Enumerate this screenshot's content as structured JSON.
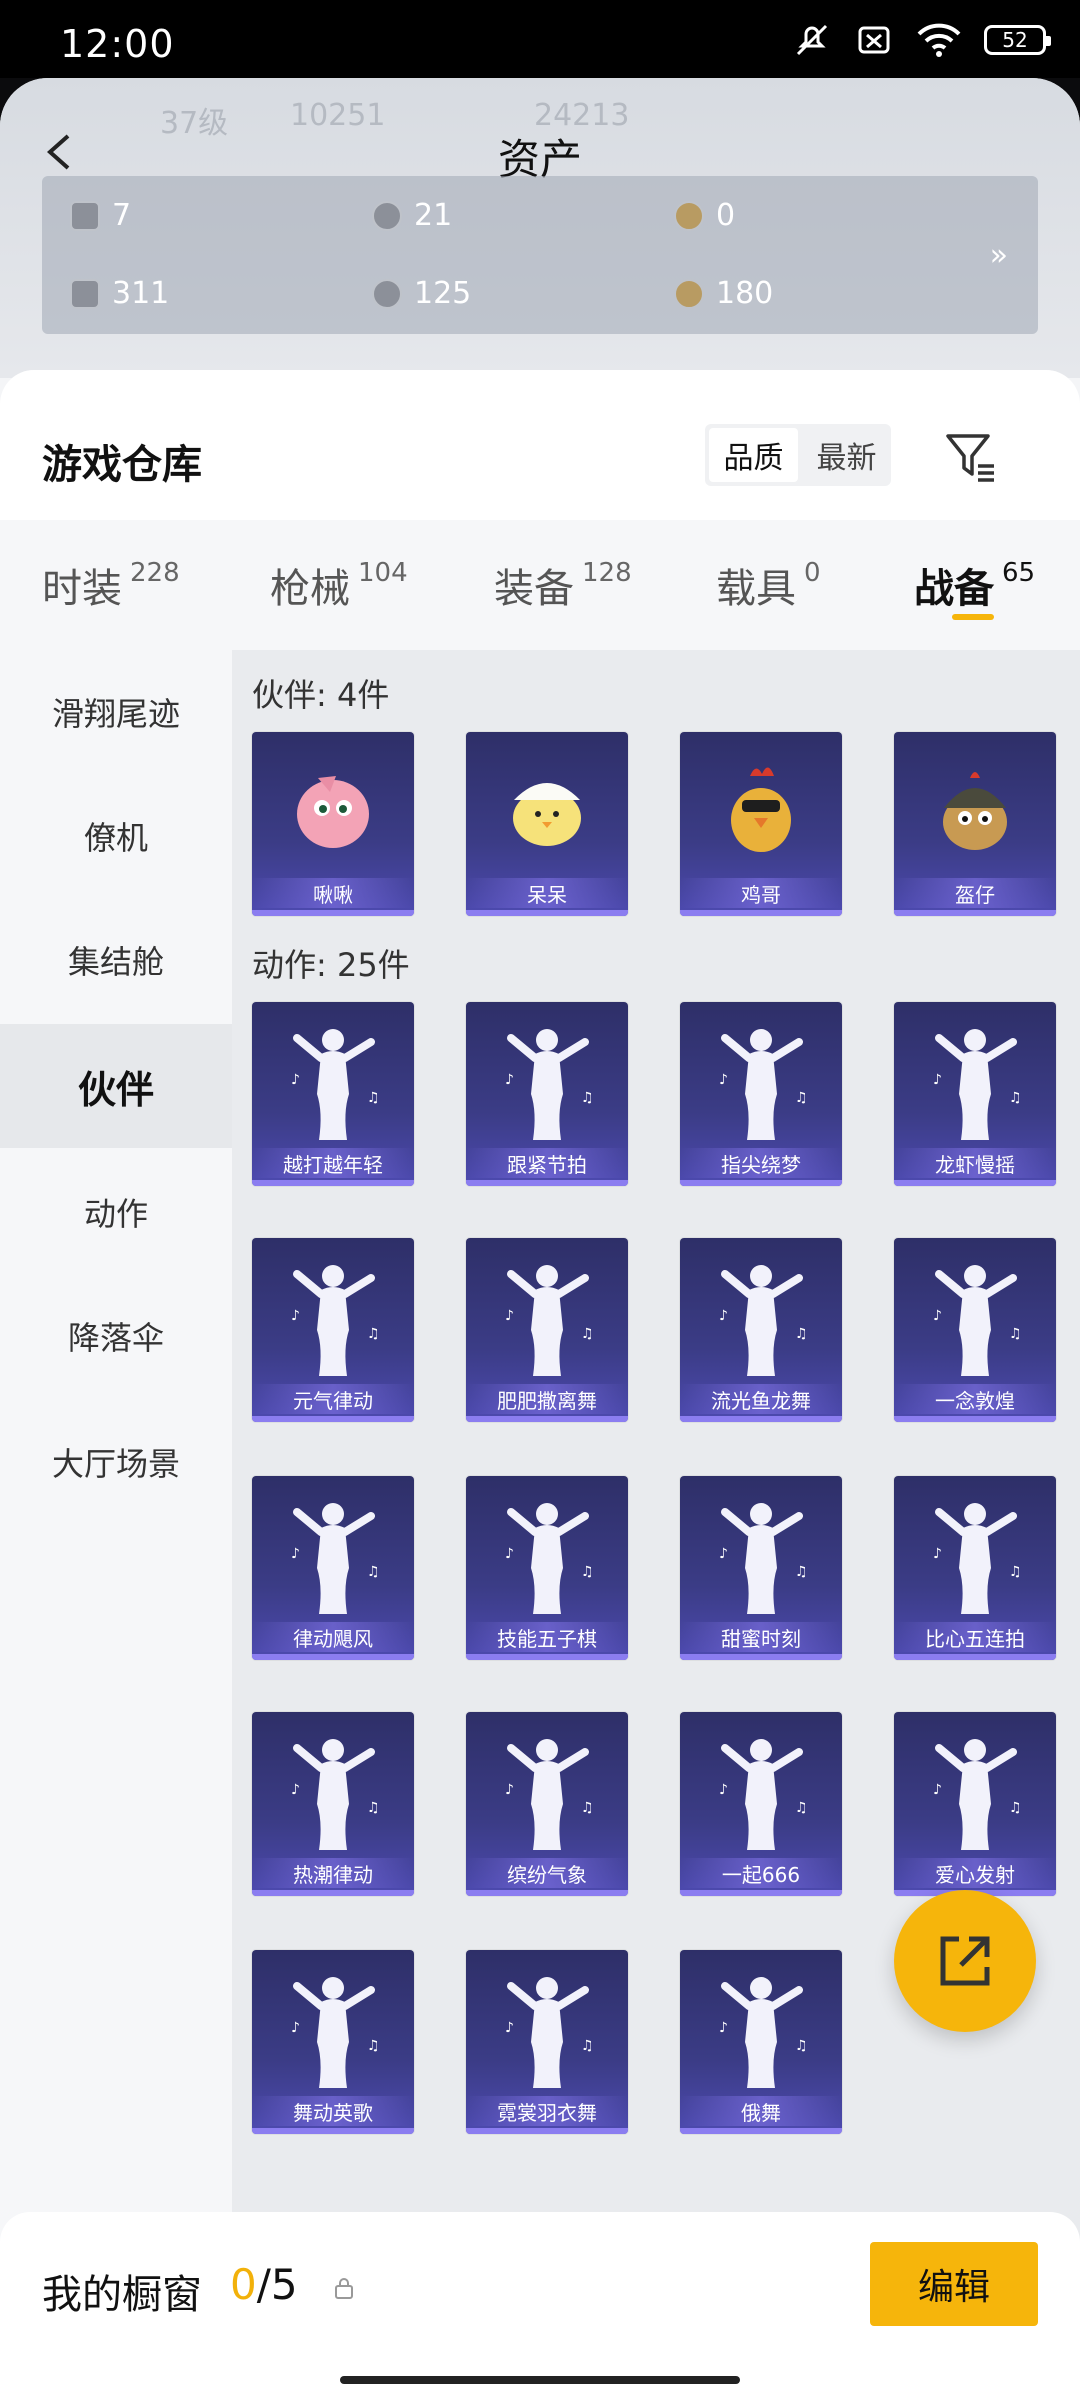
{
  "status": {
    "time": "12:00",
    "battery": "52"
  },
  "header": {
    "title": "资产",
    "ghost": [
      "37级",
      "10251",
      "24213"
    ],
    "assets": [
      {
        "icon": "card-icon",
        "value": "7"
      },
      {
        "icon": "silver-coin-icon",
        "value": "21"
      },
      {
        "icon": "gold-coin-icon",
        "value": "0"
      },
      {
        "icon": "ticket-icon",
        "value": "311"
      },
      {
        "icon": "token-icon",
        "value": "125"
      },
      {
        "icon": "bronze-coin-icon",
        "value": "180"
      }
    ],
    "more": "»"
  },
  "sheet": {
    "title": "游戏仓库",
    "sort": [
      "品质",
      "最新"
    ]
  },
  "tabs": [
    {
      "label": "时装",
      "count": "228"
    },
    {
      "label": "枪械",
      "count": "104"
    },
    {
      "label": "装备",
      "count": "128"
    },
    {
      "label": "载具",
      "count": "0"
    },
    {
      "label": "战备",
      "count": "65"
    }
  ],
  "sidebar": [
    "滑翔尾迹",
    "僚机",
    "集结舱",
    "伙伴",
    "动作",
    "降落伞",
    "大厅场景"
  ],
  "sections": {
    "companion": {
      "label": "伙伴: 4件",
      "items": [
        "啾啾",
        "呆呆",
        "鸡哥",
        "盔仔"
      ]
    },
    "emote": {
      "label": "动作: 25件",
      "items": [
        "越打越年轻",
        "跟紧节拍",
        "指尖绕梦",
        "龙虾慢摇",
        "元气律动",
        "肥肥撒离舞",
        "流光鱼龙舞",
        "一念敦煌",
        "律动飓风",
        "技能五子棋",
        "甜蜜时刻",
        "比心五连拍",
        "热潮律动",
        "缤纷气象",
        "一起666",
        "爱心发射",
        "舞动英歌",
        "霓裳羽衣舞",
        "俄舞"
      ]
    }
  },
  "bottom": {
    "label": "我的橱窗",
    "count_num": "0",
    "count_total": "/5",
    "edit": "编辑"
  },
  "colors": {
    "accent": "#f6b50b",
    "card_top": "#2e2f68",
    "card_bottom": "#4d4ab0"
  }
}
